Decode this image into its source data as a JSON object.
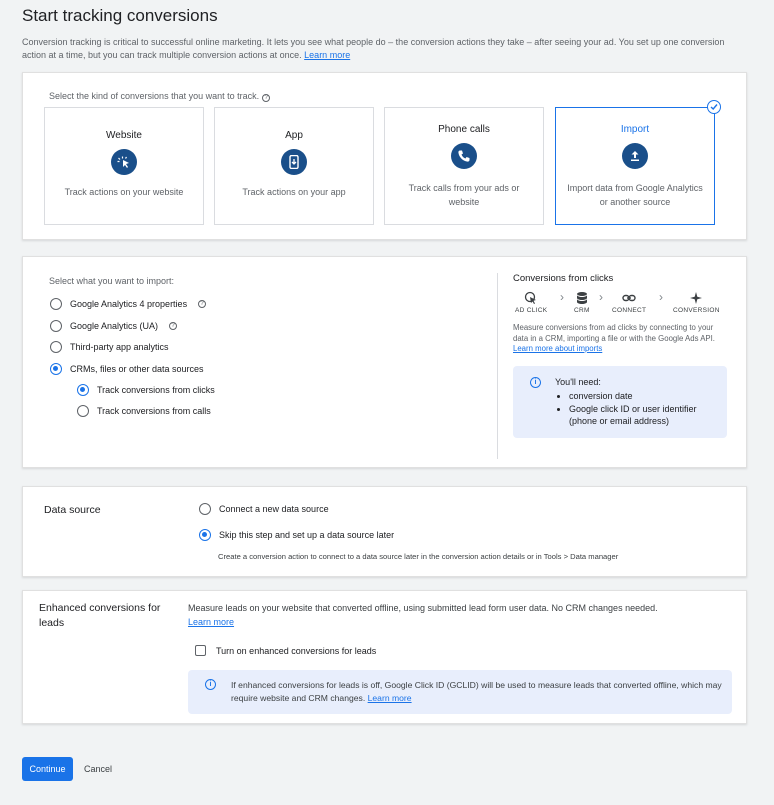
{
  "page": {
    "title": "Start tracking conversions",
    "intro": "Conversion tracking is critical to successful online marketing. It lets you see what people do – the conversion actions they take – after seeing your ad. You set up one conversion action at a time, but you can track multiple conversion actions at once.",
    "intro_link": "Learn more"
  },
  "kind": {
    "prompt": "Select the kind of conversions that you want to track.",
    "tiles": [
      {
        "title": "Website",
        "desc": "Track actions on your website",
        "icon": "cursor-click-icon"
      },
      {
        "title": "App",
        "desc": "Track actions on your app",
        "icon": "phone-app-icon"
      },
      {
        "title": "Phone calls",
        "desc": "Track calls from your ads or website",
        "icon": "phone-icon"
      },
      {
        "title": "Import",
        "desc": "Import data from Google Analytics or another source",
        "icon": "upload-icon",
        "selected": true
      }
    ]
  },
  "import": {
    "prompt": "Select what you want to import:",
    "options": [
      {
        "label": "Google Analytics 4 properties",
        "help": true
      },
      {
        "label": "Google Analytics (UA)",
        "help": true
      },
      {
        "label": "Third-party app analytics"
      },
      {
        "label": "CRMs, files or other data sources",
        "selected": true
      }
    ],
    "sub_options": [
      {
        "label": "Track conversions from clicks",
        "selected": true
      },
      {
        "label": "Track conversions from calls"
      }
    ],
    "side": {
      "title": "Conversions from clicks",
      "flow": [
        "AD CLICK",
        "CRM",
        "CONNECT",
        "CONVERSION"
      ],
      "desc": "Measure conversions from ad clicks by connecting to your data in a CRM, importing a file or with the Google Ads API.",
      "link": "Learn more about imports",
      "need_title": "You'll need:",
      "needs": [
        "conversion date",
        "Google click ID or user identifier (phone or email address)"
      ]
    }
  },
  "data_source": {
    "label": "Data source",
    "options": [
      {
        "label": "Connect a new data source"
      },
      {
        "label": "Skip this step and set up a data source later",
        "selected": true
      }
    ],
    "note": "Create a conversion action to connect to a data source later in the conversion action details or in Tools > Data manager"
  },
  "enhanced": {
    "label": "Enhanced conversions for leads",
    "desc": "Measure leads on your website that converted offline, using submitted lead form user data. No CRM changes needed.",
    "link": "Learn more",
    "checkbox": "Turn on enhanced conversions for leads",
    "info": "If enhanced conversions for leads is off, Google Click ID (GCLID) will be used to measure leads that converted offline, which may require website and CRM changes.",
    "info_link": "Learn more"
  },
  "actions": {
    "continue": "Continue",
    "cancel": "Cancel"
  },
  "colors": {
    "accent": "#1a73e8",
    "icon_bg": "#1a4f8a",
    "info_bg": "#e8eefc"
  }
}
